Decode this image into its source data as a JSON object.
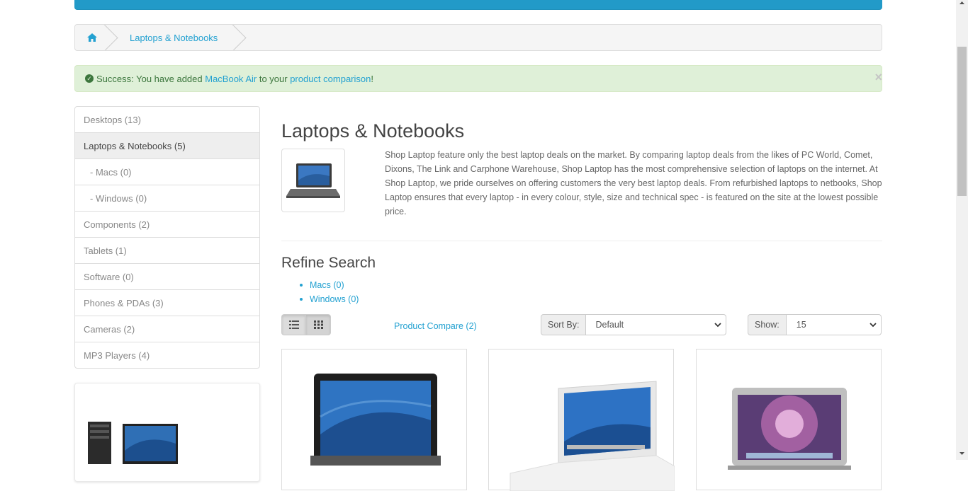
{
  "breadcrumb": {
    "home_icon": "home-icon",
    "current": "Laptops & Notebooks"
  },
  "alert": {
    "prefix": "Success: You have added ",
    "product_link": "MacBook Air",
    "middle": " to your ",
    "comparison_link": "product comparison",
    "suffix": "!",
    "close": "×",
    "icon": "check-circle-icon"
  },
  "sidebar": {
    "items": [
      {
        "label": "Desktops (13)"
      },
      {
        "label": "Laptops & Notebooks (5)"
      },
      {
        "label": "- Macs (0)"
      },
      {
        "label": "- Windows (0)"
      },
      {
        "label": "Components (2)"
      },
      {
        "label": "Tablets (1)"
      },
      {
        "label": "Software (0)"
      },
      {
        "label": "Phones & PDAs (3)"
      },
      {
        "label": "Cameras (2)"
      },
      {
        "label": "MP3 Players (4)"
      }
    ]
  },
  "category": {
    "title": "Laptops & Notebooks",
    "description": "Shop Laptop feature only the best laptop deals on the market. By comparing laptop deals from the likes of PC World, Comet, Dixons, The Link and Carphone Warehouse, Shop Laptop has the most comprehensive selection of laptops on the internet. At Shop Laptop, we pride ourselves on offering customers the very best laptop deals. From refurbished laptops to netbooks, Shop Laptop ensures that every laptop - in every colour, style, size and technical spec - is featured on the site at the lowest possible price."
  },
  "refine": {
    "title": "Refine Search",
    "links": [
      "Macs (0)",
      "Windows (0)"
    ]
  },
  "toolbar": {
    "list_icon": "list-view-icon",
    "grid_icon": "grid-view-icon",
    "compare_link": "Product Compare (2)",
    "sort_label": "Sort By:",
    "sort_value": "Default",
    "show_label": "Show:",
    "show_value": "15"
  },
  "colors": {
    "accent": "#229ac8",
    "link": "#23a1d1",
    "success_bg": "#dff0d8",
    "success_text": "#3c763d"
  }
}
